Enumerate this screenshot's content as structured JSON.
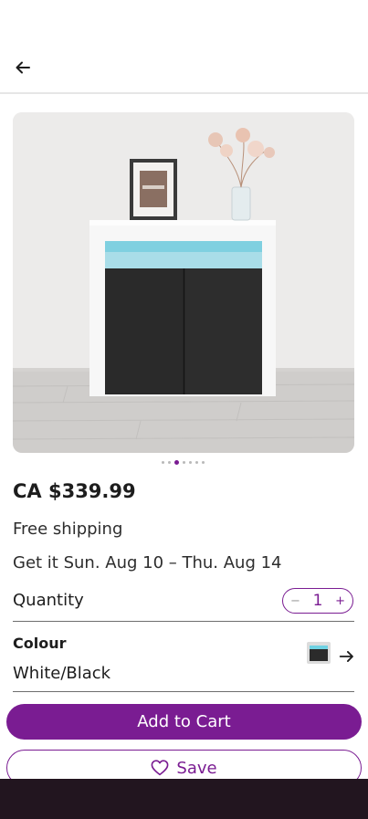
{
  "product": {
    "price": "CA $339.99",
    "shipping": "Free shipping",
    "delivery": "Get it Sun. Aug 10 – Thu. Aug 14",
    "image_dots": {
      "count": 7,
      "active_index": 2
    }
  },
  "quantity": {
    "label": "Quantity",
    "value": "1",
    "decrement_symbol": "−",
    "increment_symbol": "+"
  },
  "colour": {
    "label": "Colour",
    "value": "White/Black"
  },
  "actions": {
    "add_to_cart": "Add to Cart",
    "save": "Save"
  },
  "icons": {
    "back": "arrow-left-icon",
    "colour_next": "arrow-right-icon",
    "save": "heart-outline-icon"
  },
  "colors": {
    "accent": "#7a1c92",
    "bottom_bar": "#22151f"
  }
}
